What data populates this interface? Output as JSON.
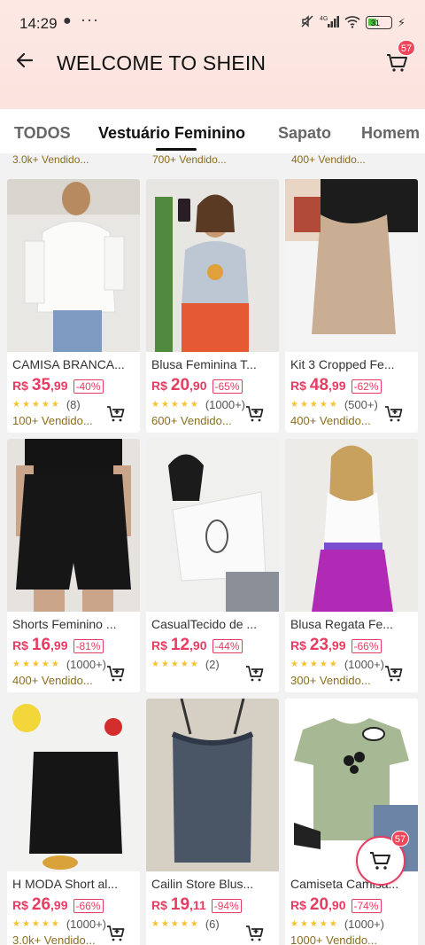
{
  "status": {
    "time": "14:29",
    "battery": "31",
    "network": "4G"
  },
  "header": {
    "title": "WELCOME TO SHEIN",
    "cart_count": "57"
  },
  "tabs": [
    {
      "label": "TODOS"
    },
    {
      "label": "Vestuário Feminino"
    },
    {
      "label": "Sapato"
    },
    {
      "label": "Homem"
    }
  ],
  "previous_row_sold": [
    "3.0k+ Vendido...",
    "700+ Vendido...",
    "400+ Vendido..."
  ],
  "products": [
    {
      "name": "CAMISA BRANCA...",
      "currency": "R$",
      "price_int": "35",
      "price_dec": ",99",
      "discount": "-40%",
      "rating_count": "(8)",
      "sold": "100+ Vendido..."
    },
    {
      "name": "Blusa Feminina T...",
      "currency": "R$",
      "price_int": "20",
      "price_dec": ",90",
      "discount": "-65%",
      "rating_count": "(1000+)",
      "sold": "600+ Vendido..."
    },
    {
      "name": "Kit 3 Cropped Fe...",
      "currency": "R$",
      "price_int": "48",
      "price_dec": ",99",
      "discount": "-62%",
      "rating_count": "(500+)",
      "sold": "400+ Vendido..."
    },
    {
      "name": "Shorts Feminino ...",
      "currency": "R$",
      "price_int": "16",
      "price_dec": ",99",
      "discount": "-81%",
      "rating_count": "(1000+)",
      "sold": "400+ Vendido..."
    },
    {
      "name": "CasualTecido de ...",
      "currency": "R$",
      "price_int": "12",
      "price_dec": ",90",
      "discount": "-44%",
      "rating_count": "(2)",
      "sold": ""
    },
    {
      "name": "Blusa Regata Fe...",
      "currency": "R$",
      "price_int": "23",
      "price_dec": ",99",
      "discount": "-66%",
      "rating_count": "(1000+)",
      "sold": "300+ Vendido..."
    },
    {
      "name": "H MODA Short al...",
      "currency": "R$",
      "price_int": "26",
      "price_dec": ",99",
      "discount": "-66%",
      "rating_count": "(1000+)",
      "sold": "3.0k+ Vendido..."
    },
    {
      "name": "Cailin Store Blus...",
      "currency": "R$",
      "price_int": "19",
      "price_dec": ",11",
      "discount": "-94%",
      "rating_count": "(6)",
      "sold": ""
    },
    {
      "name": "Camiseta Camisa...",
      "currency": "R$",
      "price_int": "20",
      "price_dec": ",90",
      "discount": "-74%",
      "rating_count": "(1000+)",
      "sold": "1000+ Vendido..."
    }
  ],
  "float_cart_count": "57",
  "colors": {
    "accent": "#e73c62",
    "star": "#f6c230",
    "header_bg": "#fde9e4"
  }
}
